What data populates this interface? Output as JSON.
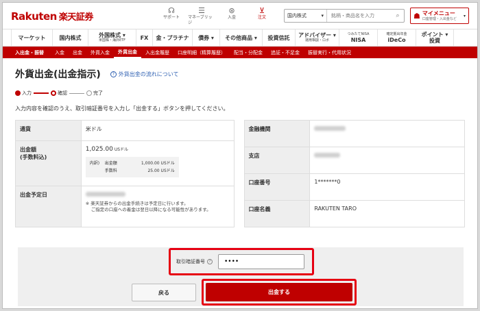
{
  "header": {
    "logo_en": "Rakuten",
    "logo_jp": "楽天証券",
    "util": [
      {
        "label": "サポート",
        "icon": "headset-icon"
      },
      {
        "label": "マネーブリッジ",
        "icon": "bridge-icon"
      },
      {
        "label": "入金",
        "icon": "deposit-icon"
      },
      {
        "label": "注文",
        "icon": "cart-icon"
      }
    ],
    "search": {
      "category": "国内株式",
      "placeholder": "銘柄・商品名を入力"
    },
    "mymenu": {
      "title": "マイメニュー",
      "sub": "口座管理・入出金など"
    }
  },
  "mainnav": [
    {
      "label": "マーケット",
      "sub": ""
    },
    {
      "label": "国内株式",
      "sub": ""
    },
    {
      "label": "外国株式 ▾",
      "sub": "米国株・海外ETF"
    },
    {
      "label": "FX",
      "sub": ""
    },
    {
      "label": "金・プラチナ",
      "sub": ""
    },
    {
      "label": "債券 ▾",
      "sub": ""
    },
    {
      "label": "その他商品 ▾",
      "sub": ""
    },
    {
      "label": "投資信託",
      "sub": ""
    },
    {
      "label": "アドバイザー ▾",
      "sub": "運用相談・ロボ"
    },
    {
      "label": "NISA",
      "sub": "つみたてNISA"
    },
    {
      "label": "iDeCo",
      "sub": "確定拠出年金"
    },
    {
      "label": "ポイント ▾",
      "sub": "投資"
    }
  ],
  "subnav": [
    "入出金・振替",
    "入金",
    "出金",
    "外貨入金",
    "外貨出金",
    "入出金履歴",
    "口座明細（精算履歴）",
    "配当・分配金",
    "追証・不足金",
    "振替実行・代用状況"
  ],
  "page": {
    "title": "外貨出金(出金指示)",
    "flow_link": "外貨出金の流れについて",
    "steps": [
      "入力",
      "確認",
      "完了"
    ],
    "instruction": "入力内容を確認のうえ、取引暗証番号を入力し「出金する」ボタンを押してください。"
  },
  "left_table": {
    "currency_label": "通貨",
    "currency_value": "米ドル",
    "amount_label": "出金額\n(手数料込)",
    "amount_value": "1,025.00",
    "amount_unit": "USドル",
    "breakdown_prefix": "内訳)",
    "breakdown": [
      {
        "name": "出金額",
        "value": "1,000.00",
        "unit": "USドル"
      },
      {
        "name": "手数料",
        "value": "25.00",
        "unit": "USドル"
      }
    ],
    "date_label": "出金予定日",
    "note1": "※ 楽天証券からの出金手続きは予定日に行います。",
    "note2": "ご指定の口座への着金は翌日以降になる可能性があります。"
  },
  "right_table": {
    "bank_label": "金融機関",
    "branch_label": "支店",
    "account_no_label": "口座番号",
    "account_no_value": "1*******0",
    "account_name_label": "口座名義",
    "account_name_value": "RAKUTEN TARO"
  },
  "form": {
    "pin_label": "取引暗証番号",
    "pin_value": "••••",
    "back_label": "戻る",
    "submit_label": "出金する"
  },
  "colors": {
    "brand": "#bf0000",
    "highlight": "#e60012"
  }
}
